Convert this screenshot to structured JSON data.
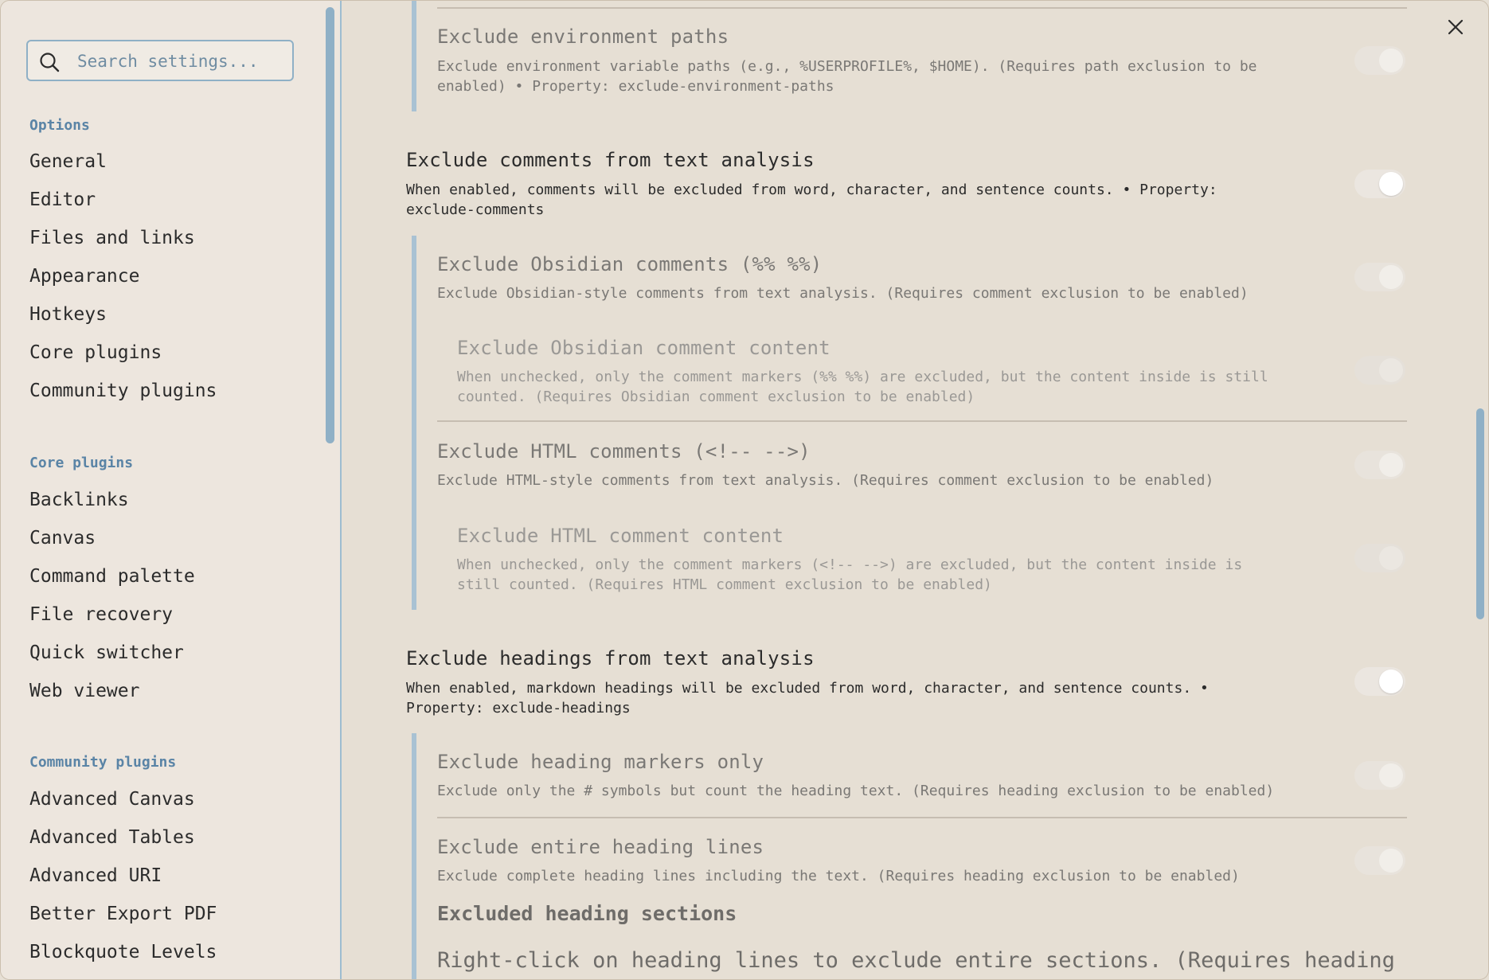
{
  "search": {
    "placeholder": "Search settings..."
  },
  "sidebar": {
    "groups": [
      {
        "title": "Options",
        "items": [
          "General",
          "Editor",
          "Files and links",
          "Appearance",
          "Hotkeys",
          "Core plugins",
          "Community plugins"
        ]
      },
      {
        "title": "Core plugins",
        "items": [
          "Backlinks",
          "Canvas",
          "Command palette",
          "File recovery",
          "Quick switcher",
          "Web viewer"
        ]
      },
      {
        "title": "Community plugins",
        "items": [
          "Advanced Canvas",
          "Advanced Tables",
          "Advanced URI",
          "Better Export PDF",
          "Blockquote Levels"
        ]
      }
    ]
  },
  "settings": {
    "env_paths": {
      "title": "Exclude environment paths",
      "desc1": "Exclude environment variable paths (e.g., %USERPROFILE%, $HOME). (Requires path exclusion to be",
      "desc2": "enabled) • Property: exclude-environment-paths",
      "enabled": true
    },
    "comments": {
      "title": "Exclude comments from text analysis",
      "desc1": "When enabled, comments will be excluded from word, character, and sentence counts. • Property:",
      "desc2": "exclude-comments",
      "enabled": true
    },
    "obsidian_comments": {
      "title": "Exclude Obsidian comments (%% %%)",
      "desc1": "Exclude Obsidian-style comments from text analysis. (Requires comment exclusion to be enabled)",
      "enabled": true
    },
    "obsidian_content": {
      "title": "Exclude Obsidian comment content",
      "desc1": "When unchecked, only the comment markers (%% %%) are excluded, but the content inside is still",
      "desc2": "counted. (Requires Obsidian comment exclusion to be enabled)",
      "enabled": true
    },
    "html_comments": {
      "title": "Exclude HTML comments (<!-- -->)",
      "desc1": "Exclude HTML-style comments from text analysis. (Requires comment exclusion to be enabled)",
      "enabled": true
    },
    "html_content": {
      "title": "Exclude HTML comment content",
      "desc1": "When unchecked, only the comment markers (<!-- -->) are excluded, but the content inside is",
      "desc2": "still counted. (Requires HTML comment exclusion to be enabled)",
      "enabled": true
    },
    "headings": {
      "title": "Exclude headings from text analysis",
      "desc1": "When enabled, markdown headings will be excluded from word, character, and sentence counts. •",
      "desc2": "Property: exclude-headings",
      "enabled": true
    },
    "heading_markers": {
      "title": "Exclude heading markers only",
      "desc1": "Exclude only the # symbols but count the heading text. (Requires heading exclusion to be enabled)",
      "enabled": true
    },
    "heading_lines": {
      "title": "Exclude entire heading lines",
      "desc1": "Exclude complete heading lines including the text. (Requires heading exclusion to be enabled)",
      "enabled": true
    },
    "heading_sections": {
      "title": "Excluded heading sections",
      "desc1": "Right-click on heading lines to exclude entire sections. (Requires heading"
    }
  }
}
